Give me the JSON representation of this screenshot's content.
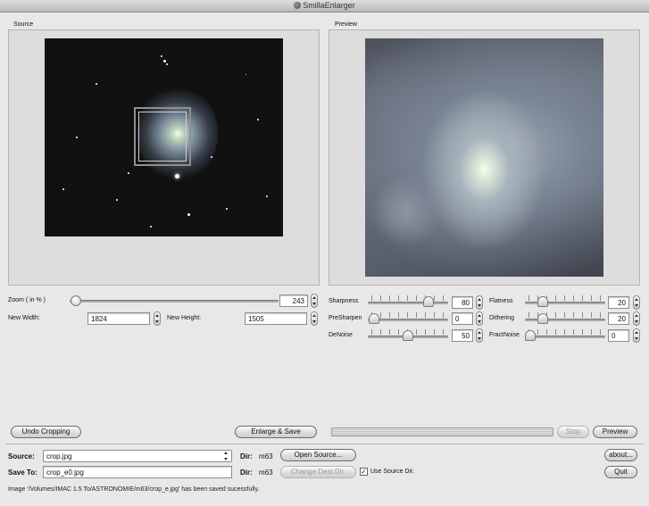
{
  "window": {
    "title": "SmillaEnlarger",
    "app_icon": "smilla-app-icon"
  },
  "source_panel": {
    "label": "Source"
  },
  "preview_panel": {
    "label": "Preview"
  },
  "zoom": {
    "label": "Zoom ( in % )",
    "value": "243",
    "slider_fraction": 0.1
  },
  "dimensions": {
    "width_label": "New Width:",
    "width_value": "1824",
    "height_label": "New Height:",
    "height_value": "1505"
  },
  "parameters": {
    "sharpness": {
      "label": "Sharpness",
      "value": "80"
    },
    "presharpen": {
      "label": "PreSharpen",
      "value": "0"
    },
    "denoise": {
      "label": "DeNoise",
      "value": "50"
    },
    "flatness": {
      "label": "Flatness",
      "value": "20"
    },
    "dithering": {
      "label": "Dithering",
      "value": "20"
    },
    "fractnoise": {
      "label": "FractNoise",
      "value": "0"
    }
  },
  "buttons": {
    "undo_cropping": "Undo Cropping",
    "enlarge_save": "Enlarge & Save",
    "stop": "Stop",
    "preview": "Preview",
    "about": "about...",
    "quit": "Quit",
    "open_source": "Open Source...",
    "change_dest_dir": "Change Dest.Dir."
  },
  "progress": {
    "value": 0
  },
  "files": {
    "source_label": "Source:",
    "source_value": "crop.jpg",
    "save_label": "Save To:",
    "save_value": "crop_e0.jpg",
    "dir_label": "Dir:",
    "source_dir": "m63",
    "dest_dir": "m63",
    "use_source_dir_label": "Use Source Dir.",
    "use_source_dir_checked": true
  },
  "status": "Image '/Volumes/IMAC 1.5 To/ASTRONOMIE/m63/crop_e.jpg' has been saved sucessfully."
}
